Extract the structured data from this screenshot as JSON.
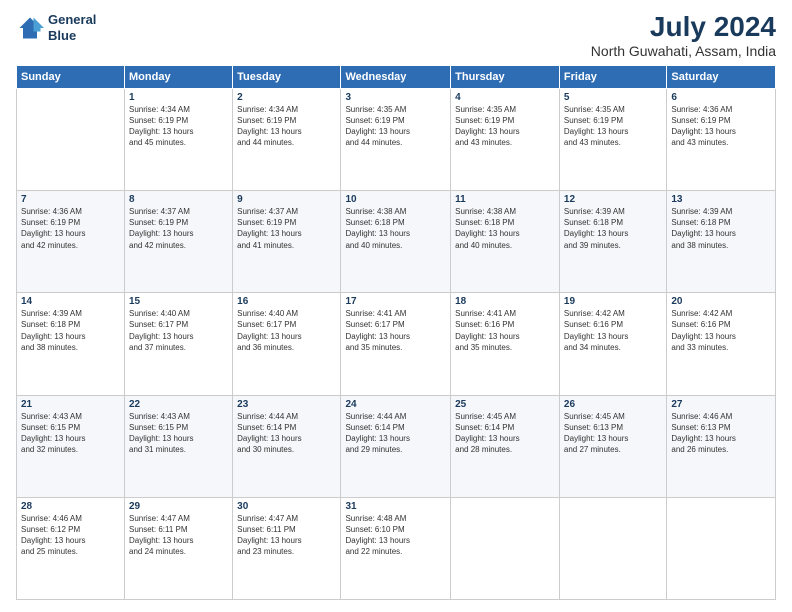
{
  "logo": {
    "line1": "General",
    "line2": "Blue"
  },
  "title": "July 2024",
  "subtitle": "North Guwahati, Assam, India",
  "header_days": [
    "Sunday",
    "Monday",
    "Tuesday",
    "Wednesday",
    "Thursday",
    "Friday",
    "Saturday"
  ],
  "weeks": [
    [
      {
        "num": "",
        "info": ""
      },
      {
        "num": "1",
        "info": "Sunrise: 4:34 AM\nSunset: 6:19 PM\nDaylight: 13 hours\nand 45 minutes."
      },
      {
        "num": "2",
        "info": "Sunrise: 4:34 AM\nSunset: 6:19 PM\nDaylight: 13 hours\nand 44 minutes."
      },
      {
        "num": "3",
        "info": "Sunrise: 4:35 AM\nSunset: 6:19 PM\nDaylight: 13 hours\nand 44 minutes."
      },
      {
        "num": "4",
        "info": "Sunrise: 4:35 AM\nSunset: 6:19 PM\nDaylight: 13 hours\nand 43 minutes."
      },
      {
        "num": "5",
        "info": "Sunrise: 4:35 AM\nSunset: 6:19 PM\nDaylight: 13 hours\nand 43 minutes."
      },
      {
        "num": "6",
        "info": "Sunrise: 4:36 AM\nSunset: 6:19 PM\nDaylight: 13 hours\nand 43 minutes."
      }
    ],
    [
      {
        "num": "7",
        "info": "Sunrise: 4:36 AM\nSunset: 6:19 PM\nDaylight: 13 hours\nand 42 minutes."
      },
      {
        "num": "8",
        "info": "Sunrise: 4:37 AM\nSunset: 6:19 PM\nDaylight: 13 hours\nand 42 minutes."
      },
      {
        "num": "9",
        "info": "Sunrise: 4:37 AM\nSunset: 6:19 PM\nDaylight: 13 hours\nand 41 minutes."
      },
      {
        "num": "10",
        "info": "Sunrise: 4:38 AM\nSunset: 6:18 PM\nDaylight: 13 hours\nand 40 minutes."
      },
      {
        "num": "11",
        "info": "Sunrise: 4:38 AM\nSunset: 6:18 PM\nDaylight: 13 hours\nand 40 minutes."
      },
      {
        "num": "12",
        "info": "Sunrise: 4:39 AM\nSunset: 6:18 PM\nDaylight: 13 hours\nand 39 minutes."
      },
      {
        "num": "13",
        "info": "Sunrise: 4:39 AM\nSunset: 6:18 PM\nDaylight: 13 hours\nand 38 minutes."
      }
    ],
    [
      {
        "num": "14",
        "info": "Sunrise: 4:39 AM\nSunset: 6:18 PM\nDaylight: 13 hours\nand 38 minutes."
      },
      {
        "num": "15",
        "info": "Sunrise: 4:40 AM\nSunset: 6:17 PM\nDaylight: 13 hours\nand 37 minutes."
      },
      {
        "num": "16",
        "info": "Sunrise: 4:40 AM\nSunset: 6:17 PM\nDaylight: 13 hours\nand 36 minutes."
      },
      {
        "num": "17",
        "info": "Sunrise: 4:41 AM\nSunset: 6:17 PM\nDaylight: 13 hours\nand 35 minutes."
      },
      {
        "num": "18",
        "info": "Sunrise: 4:41 AM\nSunset: 6:16 PM\nDaylight: 13 hours\nand 35 minutes."
      },
      {
        "num": "19",
        "info": "Sunrise: 4:42 AM\nSunset: 6:16 PM\nDaylight: 13 hours\nand 34 minutes."
      },
      {
        "num": "20",
        "info": "Sunrise: 4:42 AM\nSunset: 6:16 PM\nDaylight: 13 hours\nand 33 minutes."
      }
    ],
    [
      {
        "num": "21",
        "info": "Sunrise: 4:43 AM\nSunset: 6:15 PM\nDaylight: 13 hours\nand 32 minutes."
      },
      {
        "num": "22",
        "info": "Sunrise: 4:43 AM\nSunset: 6:15 PM\nDaylight: 13 hours\nand 31 minutes."
      },
      {
        "num": "23",
        "info": "Sunrise: 4:44 AM\nSunset: 6:14 PM\nDaylight: 13 hours\nand 30 minutes."
      },
      {
        "num": "24",
        "info": "Sunrise: 4:44 AM\nSunset: 6:14 PM\nDaylight: 13 hours\nand 29 minutes."
      },
      {
        "num": "25",
        "info": "Sunrise: 4:45 AM\nSunset: 6:14 PM\nDaylight: 13 hours\nand 28 minutes."
      },
      {
        "num": "26",
        "info": "Sunrise: 4:45 AM\nSunset: 6:13 PM\nDaylight: 13 hours\nand 27 minutes."
      },
      {
        "num": "27",
        "info": "Sunrise: 4:46 AM\nSunset: 6:13 PM\nDaylight: 13 hours\nand 26 minutes."
      }
    ],
    [
      {
        "num": "28",
        "info": "Sunrise: 4:46 AM\nSunset: 6:12 PM\nDaylight: 13 hours\nand 25 minutes."
      },
      {
        "num": "29",
        "info": "Sunrise: 4:47 AM\nSunset: 6:11 PM\nDaylight: 13 hours\nand 24 minutes."
      },
      {
        "num": "30",
        "info": "Sunrise: 4:47 AM\nSunset: 6:11 PM\nDaylight: 13 hours\nand 23 minutes."
      },
      {
        "num": "31",
        "info": "Sunrise: 4:48 AM\nSunset: 6:10 PM\nDaylight: 13 hours\nand 22 minutes."
      },
      {
        "num": "",
        "info": ""
      },
      {
        "num": "",
        "info": ""
      },
      {
        "num": "",
        "info": ""
      }
    ]
  ]
}
